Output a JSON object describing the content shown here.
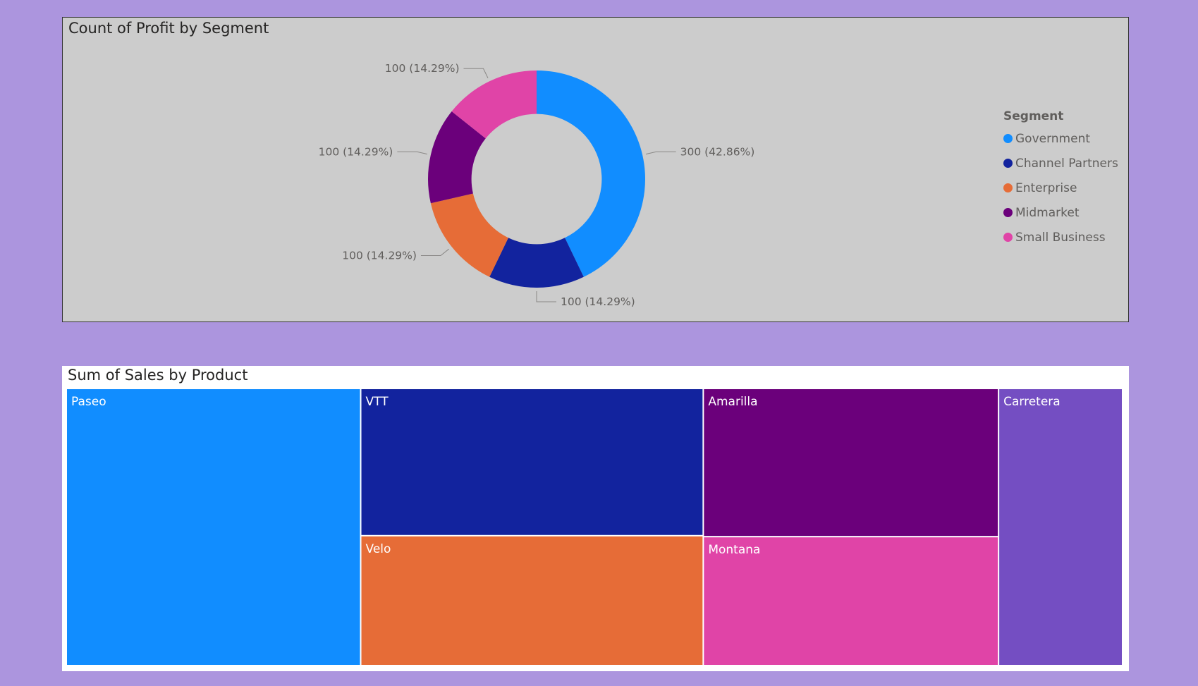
{
  "colors": {
    "Government": "#118dff",
    "Channel Partners": "#12239e",
    "Enterprise": "#e66c37",
    "Midmarket": "#6b007b",
    "Small Business": "#e044a7",
    "Carretera": "#744ec2"
  },
  "chart_data": [
    {
      "type": "pie",
      "title": "Count of Profit by Segment",
      "legend_title": "Segment",
      "legend_position": "right",
      "hole": 0.6,
      "slices": [
        {
          "name": "Government",
          "value": 300,
          "label": "300 (42.86%)"
        },
        {
          "name": "Channel Partners",
          "value": 100,
          "label": "100 (14.29%)"
        },
        {
          "name": "Enterprise",
          "value": 100,
          "label": "100 (14.29%)"
        },
        {
          "name": "Midmarket",
          "value": 100,
          "label": "100 (14.29%)"
        },
        {
          "name": "Small Business",
          "value": 100,
          "label": "100 (14.29%)"
        }
      ]
    },
    {
      "type": "treemap",
      "title": "Sum of Sales by Product",
      "items": [
        {
          "name": "Paseo",
          "value": 33.0
        },
        {
          "name": "VTT",
          "value": 20.4
        },
        {
          "name": "Velo",
          "value": 18.0
        },
        {
          "name": "Amarilla",
          "value": 17.7
        },
        {
          "name": "Montana",
          "value": 15.4
        },
        {
          "name": "Carretera",
          "value": 13.9
        }
      ]
    }
  ]
}
